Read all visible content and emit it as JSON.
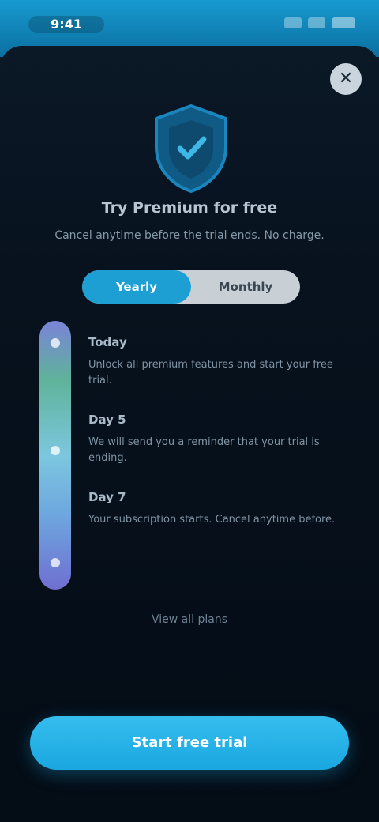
{
  "status_bar": {
    "time": "9:41"
  },
  "sheet": {
    "close_label": "✕",
    "title": "Try Premium for free",
    "subtitle": "Cancel anytime before the trial ends. No charge.",
    "plan_toggle": {
      "options": [
        "Yearly",
        "Monthly"
      ],
      "selected": "Yearly"
    },
    "timeline": [
      {
        "label": "Today",
        "desc": "Unlock all premium features and start your free trial."
      },
      {
        "label": "Day 5",
        "desc": "We will send you a reminder that your trial is ending."
      },
      {
        "label": "Day 7",
        "desc": "Your subscription starts. Cancel anytime before."
      }
    ],
    "link": "View all plans",
    "cta": "Start free trial"
  },
  "colors": {
    "accent": "#1d9fd4",
    "status_bar": "#169ad0"
  }
}
